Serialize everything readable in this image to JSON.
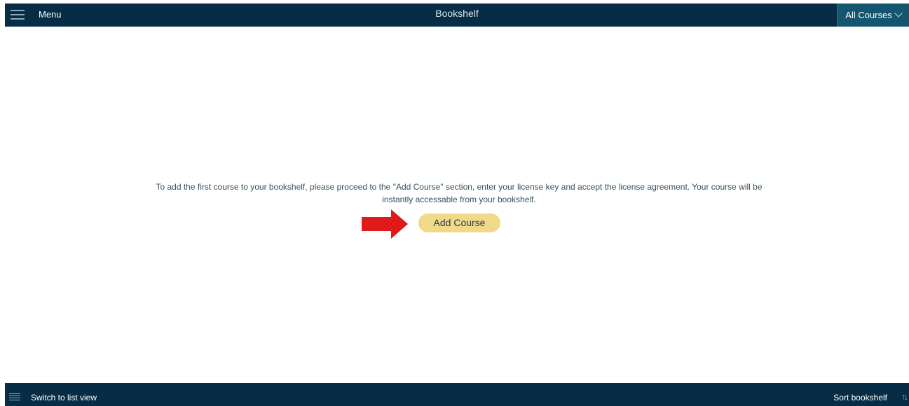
{
  "header": {
    "menu_label": "Menu",
    "title": "Bookshelf",
    "filter_label": "All Courses"
  },
  "main": {
    "empty_message": "To add the first course to your bookshelf, please proceed to the \"Add Course\" section, enter your license key and accept the license agreement. Your course will be instantly accessable from your bookshelf.",
    "add_course_label": "Add Course"
  },
  "footer": {
    "list_view_label": "Switch to list view",
    "sort_label": "Sort bookshelf"
  },
  "icons": {
    "menu": "hamburger-icon",
    "filter": "chevron-down-icon",
    "list": "list-icon",
    "sort": "sort-icon",
    "pointer": "red-arrow-icon"
  },
  "colors": {
    "bar_background": "#062d45",
    "filter_background": "#14566f",
    "button_background": "#f1d98a",
    "arrow": "#e0191b",
    "message_text": "#36505f"
  }
}
